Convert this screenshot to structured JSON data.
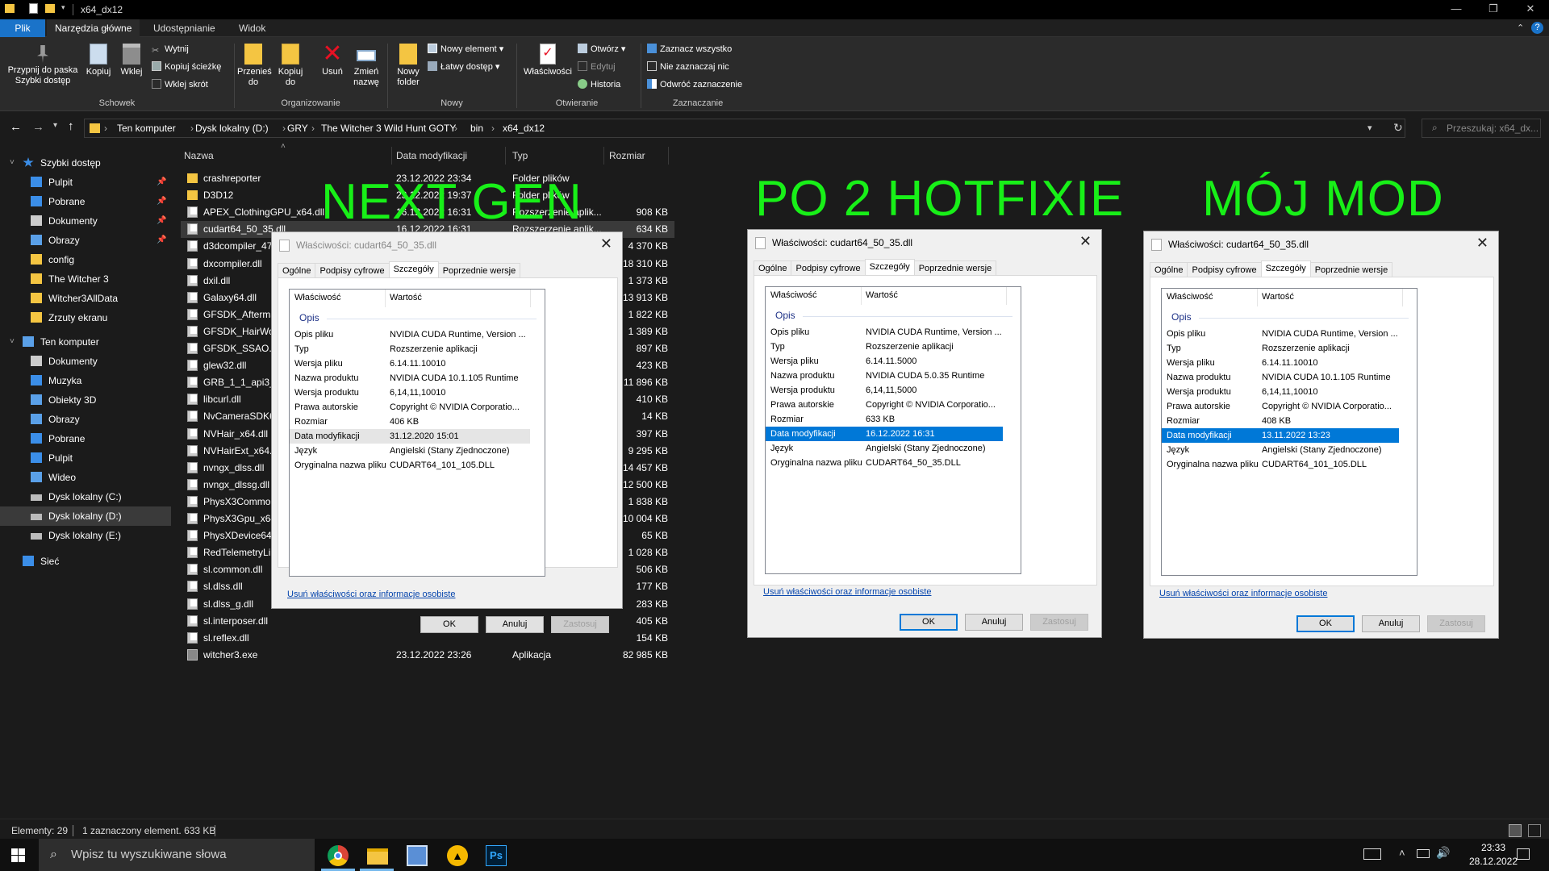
{
  "window": {
    "title": "x64_dx12"
  },
  "menu_tabs": [
    "Plik",
    "Narzędzia główne",
    "Udostępnianie",
    "Widok"
  ],
  "ribbon": {
    "clipboard": {
      "pin": "Przypnij do paska Szybki dostęp",
      "copy": "Kopiuj",
      "paste": "Wklej",
      "cut": "Wytnij",
      "copy_path": "Kopiuj ścieżkę",
      "paste_shortcut": "Wklej skrót",
      "group": "Schowek"
    },
    "organize": {
      "move": "Przenieś do",
      "copy_to": "Kopiuj do",
      "delete": "Usuń",
      "rename": "Zmień nazwę",
      "group": "Organizowanie"
    },
    "new": {
      "new_folder": "Nowy folder",
      "new_item": "Nowy element",
      "easy_access": "Łatwy dostęp",
      "group": "Nowy"
    },
    "open": {
      "properties": "Właściwości",
      "open": "Otwórz",
      "edit": "Edytuj",
      "history": "Historia",
      "group": "Otwieranie"
    },
    "select": {
      "select_all": "Zaznacz wszystko",
      "select_none": "Nie zaznaczaj nic",
      "invert": "Odwróć zaznaczenie",
      "group": "Zaznaczanie"
    }
  },
  "address": {
    "crumbs": [
      "Ten komputer",
      "Dysk lokalny (D:)",
      "GRY",
      "The Witcher 3 Wild Hunt GOTY",
      "bin",
      "x64_dx12"
    ],
    "search_placeholder": "Przeszukaj: x64_dx..."
  },
  "nav": [
    {
      "label": "Szybki dostęp",
      "icon": "star-icon",
      "pinned": false
    },
    {
      "label": "Pulpit",
      "icon": "desktop-icon",
      "pinned": true
    },
    {
      "label": "Pobrane",
      "icon": "download-icon",
      "pinned": true
    },
    {
      "label": "Dokumenty",
      "icon": "documents-icon",
      "pinned": true
    },
    {
      "label": "Obrazy",
      "icon": "pictures-icon",
      "pinned": true
    },
    {
      "label": "config",
      "icon": "folder-icon",
      "pinned": false
    },
    {
      "label": "The Witcher 3",
      "icon": "folder-icon",
      "pinned": false
    },
    {
      "label": "Witcher3AllData",
      "icon": "folder-icon",
      "pinned": false
    },
    {
      "label": "Zrzuty ekranu",
      "icon": "folder-icon",
      "pinned": false
    },
    {
      "label": "Ten komputer",
      "icon": "computer-icon",
      "pinned": false
    },
    {
      "label": "Dokumenty",
      "icon": "documents-icon",
      "pinned": false
    },
    {
      "label": "Muzyka",
      "icon": "music-icon",
      "pinned": false
    },
    {
      "label": "Obiekty 3D",
      "icon": "cube-icon",
      "pinned": false
    },
    {
      "label": "Obrazy",
      "icon": "pictures-icon",
      "pinned": false
    },
    {
      "label": "Pobrane",
      "icon": "download-icon",
      "pinned": false
    },
    {
      "label": "Pulpit",
      "icon": "desktop-icon",
      "pinned": false
    },
    {
      "label": "Wideo",
      "icon": "video-icon",
      "pinned": false
    },
    {
      "label": "Dysk lokalny (C:)",
      "icon": "drive-icon",
      "pinned": false
    },
    {
      "label": "Dysk lokalny (D:)",
      "icon": "drive-icon",
      "pinned": false,
      "selected": true
    },
    {
      "label": "Dysk lokalny (E:)",
      "icon": "drive-icon",
      "pinned": false
    },
    {
      "label": "Sieć",
      "icon": "network-icon",
      "pinned": false
    }
  ],
  "columns": {
    "name": "Nazwa",
    "date": "Data modyfikacji",
    "type": "Typ",
    "size": "Rozmiar"
  },
  "files": [
    {
      "name": "crashreporter",
      "date": "23.12.2022 23:34",
      "type": "Folder plików",
      "size": "",
      "kind": "folder"
    },
    {
      "name": "D3D12",
      "date": "23.12.2022 19:37",
      "type": "Folder plików",
      "size": "",
      "kind": "folder"
    },
    {
      "name": "APEX_ClothingGPU_x64.dll",
      "date": "16.12.2022 16:31",
      "type": "Rozszerzenie aplik...",
      "size": "908 KB",
      "kind": "dll"
    },
    {
      "name": "cudart64_50_35.dll",
      "date": "16.12.2022 16:31",
      "type": "Rozszerzenie aplik...",
      "size": "634 KB",
      "kind": "dll",
      "selected": true
    },
    {
      "name": "d3dcompiler_47.dll",
      "date": "",
      "type": "",
      "size": "4 370 KB",
      "kind": "dll"
    },
    {
      "name": "dxcompiler.dll",
      "date": "",
      "type": "",
      "size": "18 310 KB",
      "kind": "dll"
    },
    {
      "name": "dxil.dll",
      "date": "",
      "type": "",
      "size": "1 373 KB",
      "kind": "dll"
    },
    {
      "name": "Galaxy64.dll",
      "date": "",
      "type": "",
      "size": "13 913 KB",
      "kind": "dll"
    },
    {
      "name": "GFSDK_Aftermath",
      "date": "",
      "type": "",
      "size": "1 822 KB",
      "kind": "dll"
    },
    {
      "name": "GFSDK_HairWorks",
      "date": "",
      "type": "",
      "size": "1 389 KB",
      "kind": "dll"
    },
    {
      "name": "GFSDK_SSAO.win",
      "date": "",
      "type": "",
      "size": "897 KB",
      "kind": "dll"
    },
    {
      "name": "glew32.dll",
      "date": "",
      "type": "",
      "size": "423 KB",
      "kind": "dll"
    },
    {
      "name": "GRB_1_1_api3_x",
      "date": "",
      "type": "",
      "size": "11 896 KB",
      "kind": "dll"
    },
    {
      "name": "libcurl.dll",
      "date": "",
      "type": "",
      "size": "410 KB",
      "kind": "dll"
    },
    {
      "name": "NvCameraSDK64",
      "date": "",
      "type": "",
      "size": "14 KB",
      "kind": "dll"
    },
    {
      "name": "NVHair_x64.dll",
      "date": "",
      "type": "",
      "size": "397 KB",
      "kind": "dll"
    },
    {
      "name": "NVHairExt_x64.dll",
      "date": "",
      "type": "",
      "size": "9 295 KB",
      "kind": "dll"
    },
    {
      "name": "nvngx_dlss.dll",
      "date": "",
      "type": "",
      "size": "14 457 KB",
      "kind": "dll"
    },
    {
      "name": "nvngx_dlssg.dll",
      "date": "",
      "type": "",
      "size": "12 500 KB",
      "kind": "dll"
    },
    {
      "name": "PhysX3Common",
      "date": "",
      "type": "",
      "size": "1 838 KB",
      "kind": "dll"
    },
    {
      "name": "PhysX3Gpu_x64",
      "date": "",
      "type": "",
      "size": "10 004 KB",
      "kind": "dll"
    },
    {
      "name": "PhysXDevice64",
      "date": "",
      "type": "",
      "size": "65 KB",
      "kind": "dll"
    },
    {
      "name": "RedTelemetryLib",
      "date": "",
      "type": "",
      "size": "1 028 KB",
      "kind": "dll"
    },
    {
      "name": "sl.common.dll",
      "date": "",
      "type": "",
      "size": "506 KB",
      "kind": "dll"
    },
    {
      "name": "sl.dlss.dll",
      "date": "",
      "type": "",
      "size": "177 KB",
      "kind": "dll"
    },
    {
      "name": "sl.dlss_g.dll",
      "date": "",
      "type": "",
      "size": "283 KB",
      "kind": "dll"
    },
    {
      "name": "sl.interposer.dll",
      "date": "",
      "type": "",
      "size": "405 KB",
      "kind": "dll"
    },
    {
      "name": "sl.reflex.dll",
      "date": "",
      "type": "",
      "size": "154 KB",
      "kind": "dll"
    },
    {
      "name": "witcher3.exe",
      "date": "23.12.2022 23:26",
      "type": "Aplikacja",
      "size": "82 985 KB",
      "kind": "exe"
    }
  ],
  "overlay_labels": [
    "NEXT GEN",
    "PO 2 HOTFIXIE",
    "MÓJ MOD"
  ],
  "dialog_common": {
    "title": "Właściwości: cudart64_50_35.dll",
    "tabs": [
      "Ogólne",
      "Podpisy cyfrowe",
      "Szczegóły",
      "Poprzednie wersje"
    ],
    "col_property": "Właściwość",
    "col_value": "Wartość",
    "group": "Opis",
    "link": "Usuń właściwości oraz informacje osobiste",
    "ok": "OK",
    "cancel": "Anuluj",
    "apply": "Zastosuj",
    "keys": [
      "Opis pliku",
      "Typ",
      "Wersja pliku",
      "Nazwa produktu",
      "Wersja produktu",
      "Prawa autorskie",
      "Rozmiar",
      "Data modyfikacji",
      "Język",
      "Oryginalna nazwa pliku"
    ]
  },
  "dialogs": [
    {
      "values": [
        "NVIDIA CUDA Runtime, Version ...",
        "Rozszerzenie aplikacji",
        "6.14.11.10010",
        "NVIDIA CUDA 10.1.105 Runtime",
        "6,14,11,10010",
        "Copyright © NVIDIA Corporatio...",
        "406 KB",
        "31.12.2020 15:01",
        "Angielski (Stany Zjednoczone)",
        "CUDART64_101_105.DLL"
      ]
    },
    {
      "values": [
        "NVIDIA CUDA Runtime, Version ...",
        "Rozszerzenie aplikacji",
        "6.14.11.5000",
        "NVIDIA CUDA 5.0.35 Runtime",
        "6,14,11,5000",
        "Copyright © NVIDIA Corporatio...",
        "633 KB",
        "16.12.2022 16:31",
        "Angielski (Stany Zjednoczone)",
        "CUDART64_50_35.DLL"
      ]
    },
    {
      "values": [
        "NVIDIA CUDA Runtime, Version ...",
        "Rozszerzenie aplikacji",
        "6.14.11.10010",
        "NVIDIA CUDA 10.1.105 Runtime",
        "6,14,11,10010",
        "Copyright © NVIDIA Corporatio...",
        "408 KB",
        "13.11.2022 13:23",
        "Angielski (Stany Zjednoczone)",
        "CUDART64_101_105.DLL"
      ]
    }
  ],
  "status": {
    "count": "Elementy: 29",
    "selected": "1 zaznaczony element. 633 KB"
  },
  "taskbar": {
    "search_placeholder": "Wpisz tu wyszukiwane słowa",
    "time": "23:33",
    "date": "28.12.2022"
  },
  "colors": {
    "accent": "#0078d7",
    "overlay_text": "#18f018",
    "file_tab": "#1a73c9",
    "folder": "#f4c542"
  }
}
